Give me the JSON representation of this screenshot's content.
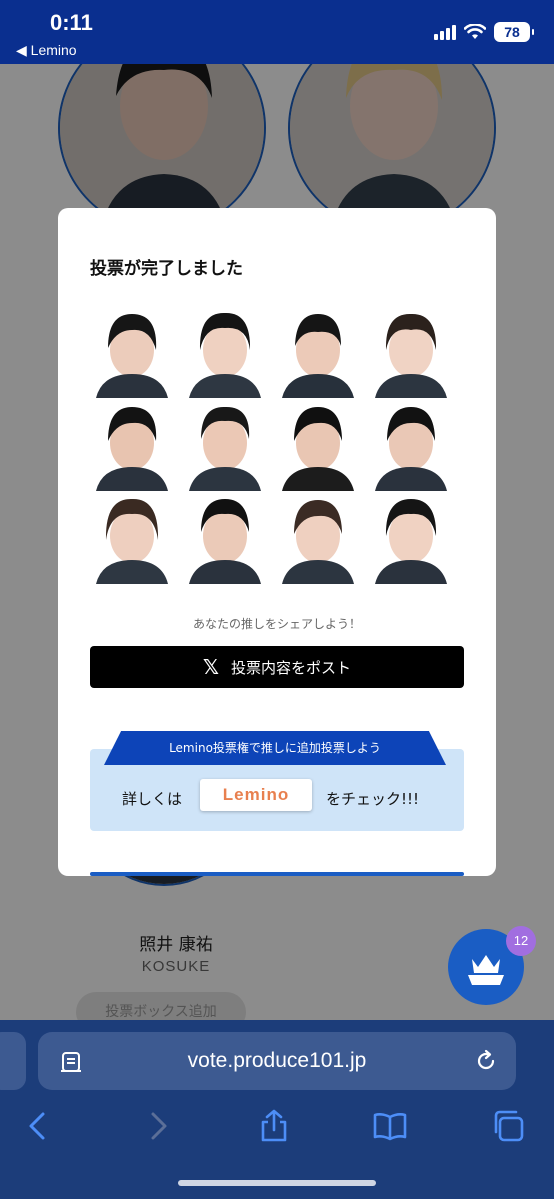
{
  "status_bar": {
    "time": "0:11",
    "back_label": "◀ Lemino",
    "battery": "78"
  },
  "background": {
    "member_name_jp": "照井 康祐",
    "member_name_en": "KOSUKE",
    "add_box_button": "投票ボックス追加"
  },
  "fab": {
    "badge_count": "12"
  },
  "modal": {
    "title": "投票が完了しました",
    "share_prompt": "あなたの推しをシェアしよう！",
    "post_button": "投票内容をポスト",
    "x_logo": "𝕏",
    "promo_ribbon": "Lemino投票権で推しに追加投票しよう",
    "promo_prefix": "詳しくは",
    "lemino_button": "Lemino",
    "promo_suffix": "をチェック!!!"
  },
  "browser": {
    "url": "vote.produce101.jp"
  },
  "colors": {
    "status_bar": "#0a2f8f",
    "accent_blue": "#1a5dc4",
    "promo_bg": "#cfe4f8",
    "lemino_orange": "#e8804f",
    "browser_bg": "#1c3d7a"
  }
}
